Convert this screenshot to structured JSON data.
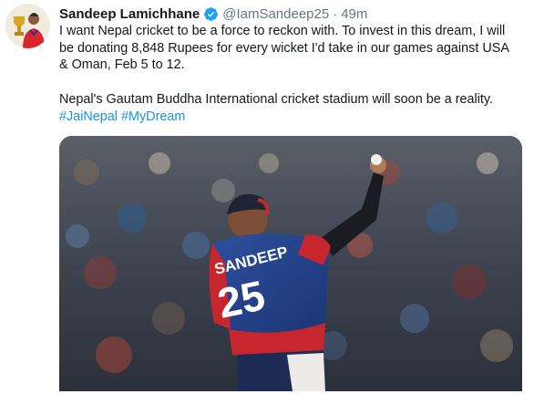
{
  "tweet": {
    "author_name": "Sandeep Lamichhane",
    "handle": "@IamSandeep25",
    "separator": "·",
    "timestamp": "49m",
    "text_line1": "I want Nepal cricket to be a force to reckon with. To invest in this dream, I will be donating 8,848 Rupees for every wicket I'd take in our games against USA & Oman, Feb 5 to 12.",
    "text_line2": "Nepal's Gautam Buddha International cricket stadium will soon be a reality.",
    "hashtags": [
      "#JaiNepal",
      "#MyDream"
    ],
    "verified_icon": "verified-badge-icon",
    "verified_color": "#1da1f2"
  },
  "media": {
    "jersey_name": "SANDEEP",
    "jersey_number": "25"
  },
  "colors": {
    "link": "#1b95e0",
    "muted": "#657786",
    "text": "#14171a"
  }
}
